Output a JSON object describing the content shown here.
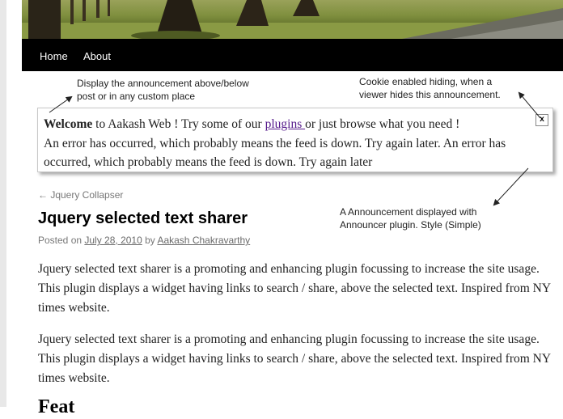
{
  "nav": {
    "items": [
      {
        "label": "Home"
      },
      {
        "label": "About"
      }
    ]
  },
  "annotations": {
    "placement_line1": "Display the announcement above/below",
    "placement_line2": "post or in any custom place",
    "cookie_line1": "Cookie enabled hiding, when a",
    "cookie_line2": "viewer hides this announcement.",
    "displayed_line1": "A Announcement displayed with",
    "displayed_line2": "Announcer plugin. Style (Simple)"
  },
  "announcement": {
    "welcome": "Welcome",
    "text_a": " to Aakash Web ! Try some of our ",
    "link": "plugins ",
    "text_b": "or just browse what you need !",
    "error_text": "An error has occurred, which probably means the feed is down. Try again later. An error has occurred, which probably means the feed is down. Try again later",
    "close_label": "x"
  },
  "post": {
    "back_link": "← Jquery Collapser",
    "title": "Jquery selected text sharer",
    "posted_on": "Posted on ",
    "date": "July 28, 2010",
    "by": " by ",
    "author": "Aakash Chakravarthy",
    "paragraphs": [
      "Jquery selected text sharer is a promoting and enhancing plugin focussing to increase the site usage. This plugin displays a widget having links to search / share, above the selected text. Inspired from NY times website.",
      "Jquery selected text sharer is a promoting and enhancing plugin focussing to increase the site usage. This plugin displays a widget having links to search / share, above the selected text. Inspired from NY times website."
    ],
    "next_heading": "Feat"
  },
  "colors": {
    "navbar": "#000000",
    "link_visited": "#551a8b",
    "meta_text": "#777777"
  }
}
